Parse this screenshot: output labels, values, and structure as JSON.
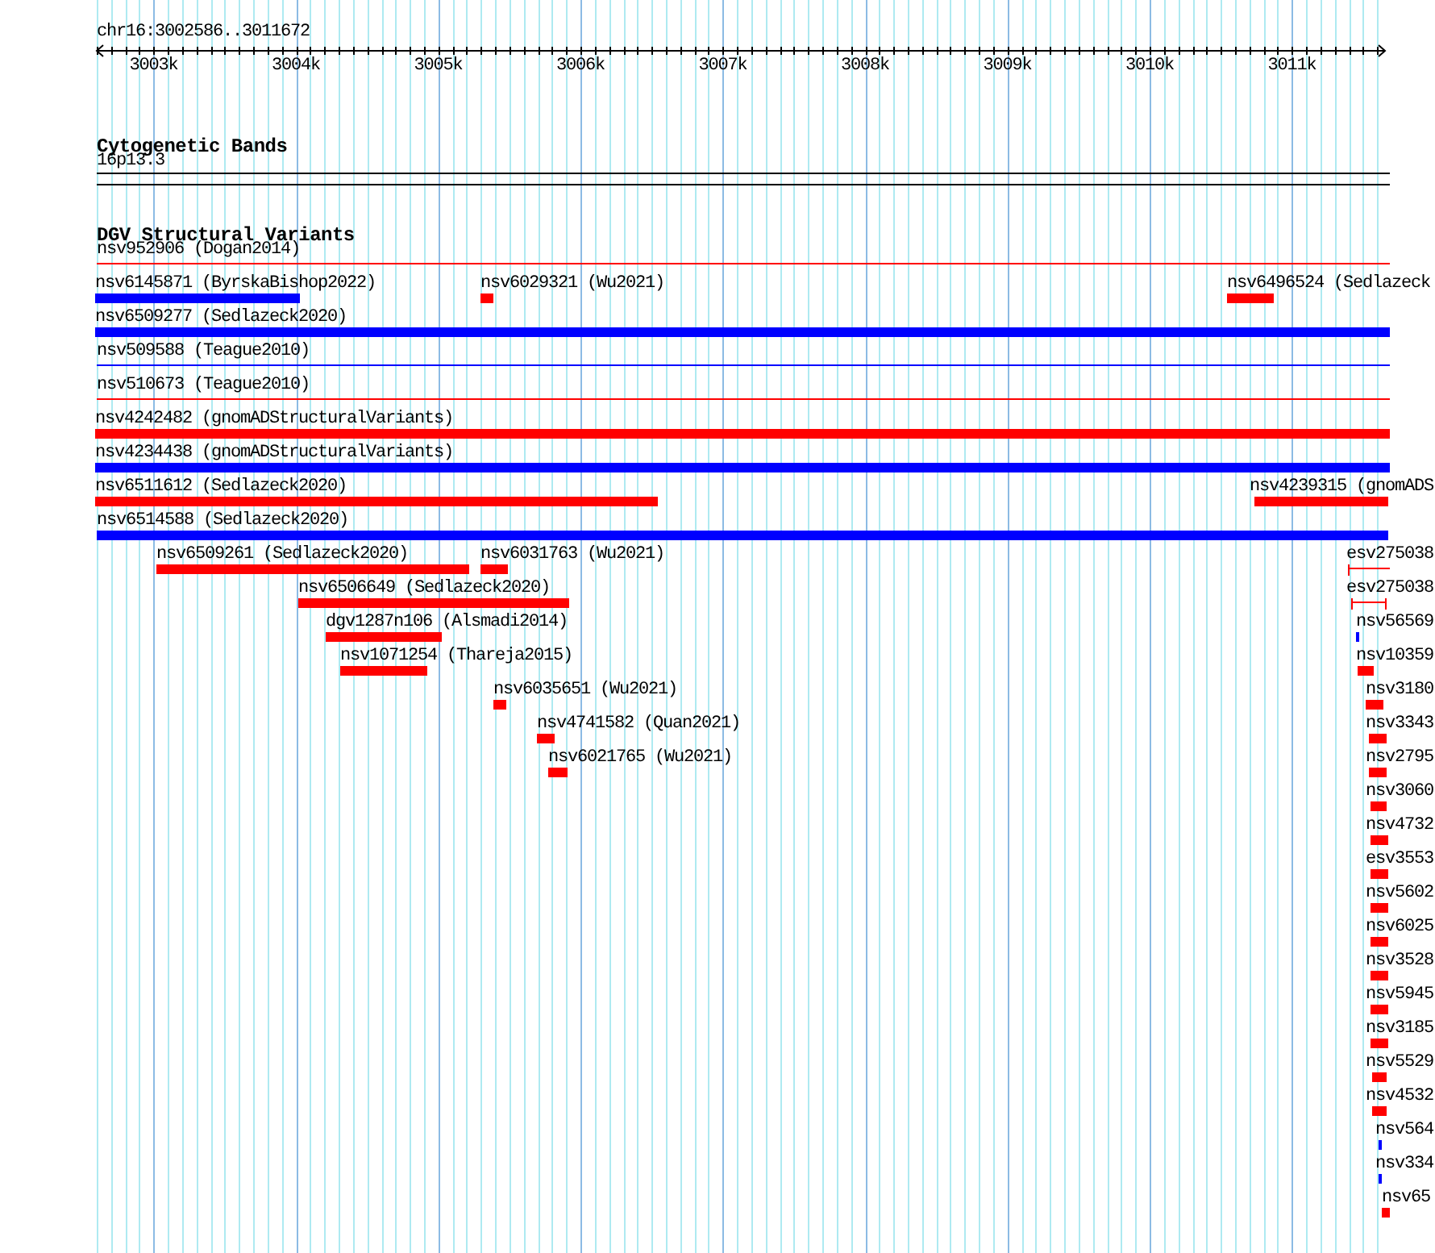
{
  "ruler": {
    "locus": "chr16:3002586..3011672",
    "ticks": [
      "3003k",
      "3004k",
      "3005k",
      "3006k",
      "3007k",
      "3008k",
      "3009k",
      "3010k",
      "3011k"
    ]
  },
  "tracks": [
    {
      "title": "Cytogenetic Bands",
      "rows": [
        {
          "features": [
            {
              "label": "16p13.3",
              "kind": "band"
            }
          ]
        }
      ]
    },
    {
      "title": "DGV Structural Variants",
      "rows": [
        {
          "features": [
            {
              "label": "nsv952906 (Dogan2014)",
              "kind": "line",
              "color": "#ff0000"
            }
          ]
        },
        {
          "features": [
            {
              "label": "nsv6145871 (ByrskaBishop2022)",
              "kind": "bar",
              "color": "#0000ff"
            },
            {
              "label": "nsv6029321 (Wu2021)",
              "kind": "bar",
              "color": "#ff0000"
            },
            {
              "label": "nsv6496524 (Sedlazeck",
              "kind": "bar",
              "color": "#ff0000"
            }
          ]
        },
        {
          "features": [
            {
              "label": "nsv6509277 (Sedlazeck2020)",
              "kind": "bar",
              "color": "#0000ff"
            }
          ]
        },
        {
          "features": [
            {
              "label": "nsv509588 (Teague2010)",
              "kind": "line",
              "color": "#0000ff"
            }
          ]
        },
        {
          "features": [
            {
              "label": "nsv510673 (Teague2010)",
              "kind": "line",
              "color": "#ff0000"
            }
          ]
        },
        {
          "features": [
            {
              "label": "nsv4242482 (gnomADStructuralVariants)",
              "kind": "bar",
              "color": "#ff0000"
            }
          ]
        },
        {
          "features": [
            {
              "label": "nsv4234438 (gnomADStructuralVariants)",
              "kind": "bar",
              "color": "#0000ff"
            }
          ]
        },
        {
          "features": [
            {
              "label": "nsv6511612 (Sedlazeck2020)",
              "kind": "bar",
              "color": "#ff0000"
            },
            {
              "label": "nsv4239315 (gnomADS",
              "kind": "bar",
              "color": "#ff0000"
            }
          ]
        },
        {
          "features": [
            {
              "label": "nsv6514588 (Sedlazeck2020)",
              "kind": "bar",
              "color": "#0000ff"
            }
          ]
        },
        {
          "features": [
            {
              "label": "nsv6509261 (Sedlazeck2020)",
              "kind": "bar",
              "color": "#ff0000"
            },
            {
              "label": "nsv6031763 (Wu2021)",
              "kind": "bar",
              "color": "#ff0000"
            },
            {
              "label": "esv275038",
              "kind": "interval",
              "color": "#ff0000"
            }
          ]
        },
        {
          "features": [
            {
              "label": "nsv6506649 (Sedlazeck2020)",
              "kind": "bar",
              "color": "#ff0000"
            },
            {
              "label": "esv275038",
              "kind": "interval",
              "color": "#ff0000"
            }
          ]
        },
        {
          "features": [
            {
              "label": "dgv1287n106 (Alsmadi2014)",
              "kind": "bar",
              "color": "#ff0000"
            },
            {
              "label": "nsv56569",
              "kind": "bar",
              "color": "#0000ff"
            }
          ]
        },
        {
          "features": [
            {
              "label": "nsv1071254 (Thareja2015)",
              "kind": "bar",
              "color": "#ff0000"
            },
            {
              "label": "nsv10359",
              "kind": "bar",
              "color": "#ff0000"
            }
          ]
        },
        {
          "features": [
            {
              "label": "nsv6035651 (Wu2021)",
              "kind": "bar",
              "color": "#ff0000"
            },
            {
              "label": "nsv3180",
              "kind": "bar",
              "color": "#ff0000"
            }
          ]
        },
        {
          "features": [
            {
              "label": "nsv4741582 (Quan2021)",
              "kind": "bar",
              "color": "#ff0000"
            },
            {
              "label": "nsv3343",
              "kind": "bar",
              "color": "#ff0000"
            }
          ]
        },
        {
          "features": [
            {
              "label": "nsv6021765 (Wu2021)",
              "kind": "bar",
              "color": "#ff0000"
            },
            {
              "label": "nsv2795",
              "kind": "bar",
              "color": "#ff0000"
            }
          ]
        },
        {
          "features": [
            {
              "label": "nsv3060",
              "kind": "bar",
              "color": "#ff0000"
            }
          ]
        },
        {
          "features": [
            {
              "label": "nsv4732",
              "kind": "bar",
              "color": "#ff0000"
            }
          ]
        },
        {
          "features": [
            {
              "label": "esv3553",
              "kind": "bar",
              "color": "#ff0000"
            }
          ]
        },
        {
          "features": [
            {
              "label": "nsv5602",
              "kind": "bar",
              "color": "#ff0000"
            }
          ]
        },
        {
          "features": [
            {
              "label": "nsv6025",
              "kind": "bar",
              "color": "#ff0000"
            }
          ]
        },
        {
          "features": [
            {
              "label": "nsv3528",
              "kind": "bar",
              "color": "#ff0000"
            }
          ]
        },
        {
          "features": [
            {
              "label": "nsv5945",
              "kind": "bar",
              "color": "#ff0000"
            }
          ]
        },
        {
          "features": [
            {
              "label": "nsv3185",
              "kind": "bar",
              "color": "#ff0000"
            }
          ]
        },
        {
          "features": [
            {
              "label": "nsv5529",
              "kind": "bar",
              "color": "#ff0000"
            }
          ]
        },
        {
          "features": [
            {
              "label": "nsv4532",
              "kind": "bar",
              "color": "#ff0000"
            }
          ]
        },
        {
          "features": [
            {
              "label": "nsv564",
              "kind": "bar",
              "color": "#0000ff"
            }
          ]
        },
        {
          "features": [
            {
              "label": "nsv334",
              "kind": "bar",
              "color": "#0000ff"
            }
          ]
        },
        {
          "features": [
            {
              "label": "nsv65",
              "kind": "bar",
              "color": "#ff0000"
            }
          ]
        }
      ]
    }
  ]
}
